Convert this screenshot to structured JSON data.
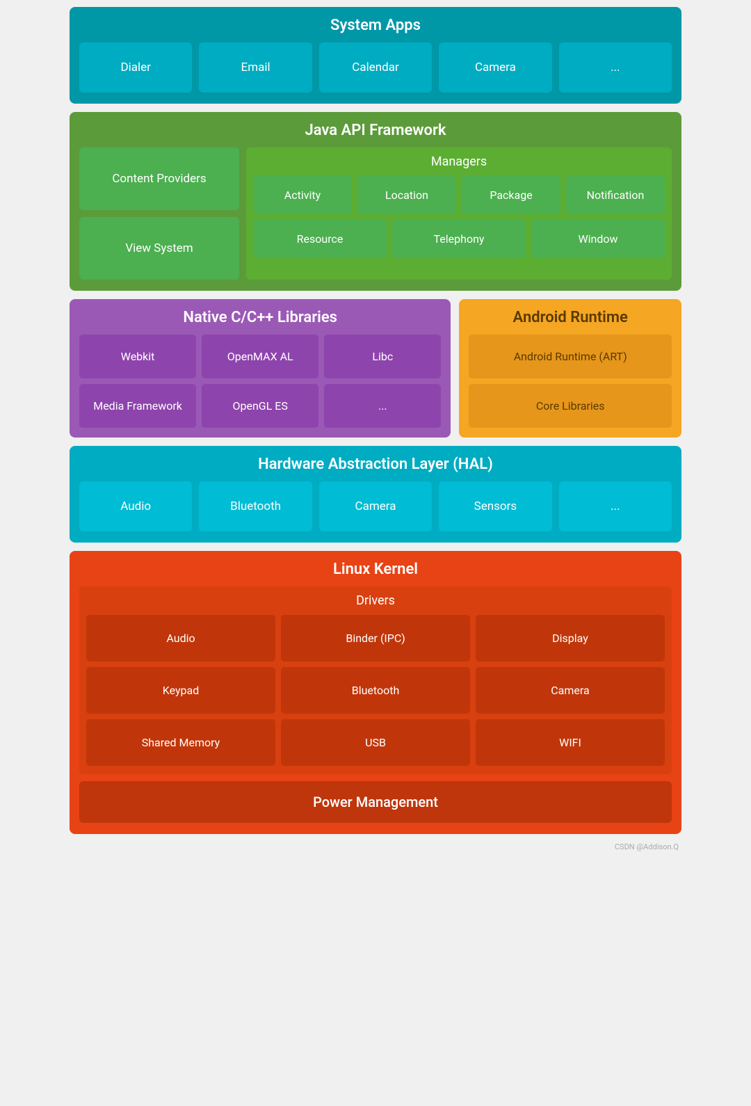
{
  "systemApps": {
    "title": "System Apps",
    "items": [
      "Dialer",
      "Email",
      "Calendar",
      "Camera",
      "..."
    ]
  },
  "javaApi": {
    "title": "Java API Framework",
    "left": [
      "Content Providers",
      "View System"
    ],
    "managers": {
      "title": "Managers",
      "row1": [
        "Activity",
        "Location",
        "Package",
        "Notification"
      ],
      "row2": [
        "Resource",
        "Telephony",
        "Window"
      ]
    }
  },
  "nativeLibs": {
    "title": "Native C/C++ Libraries",
    "row1": [
      "Webkit",
      "OpenMAX AL",
      "Libc"
    ],
    "row2": [
      "Media Framework",
      "OpenGL ES",
      "..."
    ]
  },
  "androidRuntime": {
    "title": "Android Runtime",
    "items": [
      "Android Runtime (ART)",
      "Core Libraries"
    ]
  },
  "hal": {
    "title": "Hardware Abstraction Layer (HAL)",
    "items": [
      "Audio",
      "Bluetooth",
      "Camera",
      "Sensors",
      "..."
    ]
  },
  "linuxKernel": {
    "title": "Linux Kernel",
    "drivers": {
      "title": "Drivers",
      "row1": [
        "Audio",
        "Binder (IPC)",
        "Display"
      ],
      "row2": [
        "Keypad",
        "Bluetooth",
        "Camera"
      ],
      "row3": [
        "Shared Memory",
        "USB",
        "WIFI"
      ]
    },
    "powerManagement": "Power Management"
  },
  "watermark": "CSDN @Addison.Q"
}
